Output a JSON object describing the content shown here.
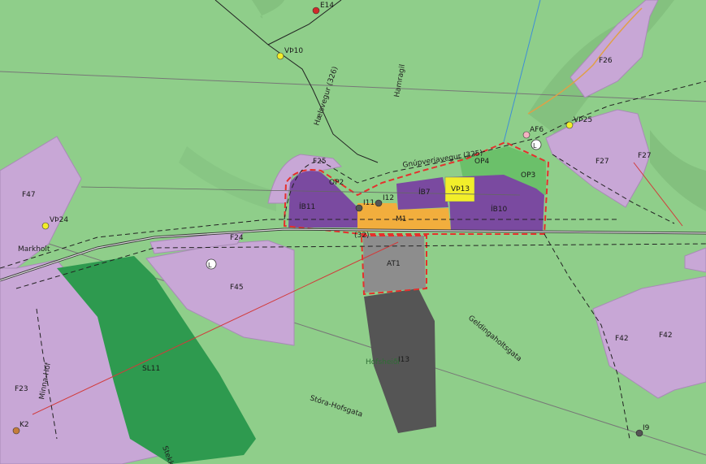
{
  "map": {
    "colors": {
      "background": "#8fce8a",
      "residential_area": "#c8a7d6",
      "residential_zone": "#7a4aa0",
      "mixed_zone": "#f2ae3d",
      "service_zone": "#f2ee2a",
      "industrial_zone": "#8d8d8d",
      "quarry": "#555555",
      "forest": "#2e9a4f",
      "boundary": "#e5302d"
    },
    "zones": {
      "ib11": "ÍB11",
      "ib7": "ÍB7",
      "ib10": "ÍB10",
      "vth13": "VÞ13",
      "m1": "M1",
      "at1": "AT1",
      "i11": "I11",
      "i12": "I12",
      "i13": "I13",
      "op2": "OP2",
      "op3": "OP3",
      "op4": "OP4",
      "af6": "AF6",
      "f23": "F23",
      "f24": "F24",
      "f25": "F25",
      "f26": "F26",
      "f27a": "F27",
      "f27b": "F27",
      "f42a": "F42",
      "f42b": "F42",
      "f45": "F45",
      "f47": "F47",
      "sl11": "SL11"
    },
    "points": {
      "e14": "E14",
      "vth10": "VÞ10",
      "vth24": "VÞ24",
      "vth25": "VÞ25",
      "k2": "K2",
      "i9": "I9",
      "l1": "L",
      "l2": "L"
    },
    "roads": {
      "haelsvegur": "Hælsvegur (326)",
      "gnupverjavegur": "Gnúpverjavegur (325)",
      "main_road": "(32)",
      "hamragil": "Hamragil",
      "geldingaholtsgata": "Geldingaholtsgata",
      "storahofsgata": "Stóra-Hofsgata",
      "minnahof": "Minna-Hof",
      "markholt": "Markholt",
      "stekk": "Stekk"
    },
    "places": {
      "hofsheidi": "Hofsheiði"
    }
  }
}
